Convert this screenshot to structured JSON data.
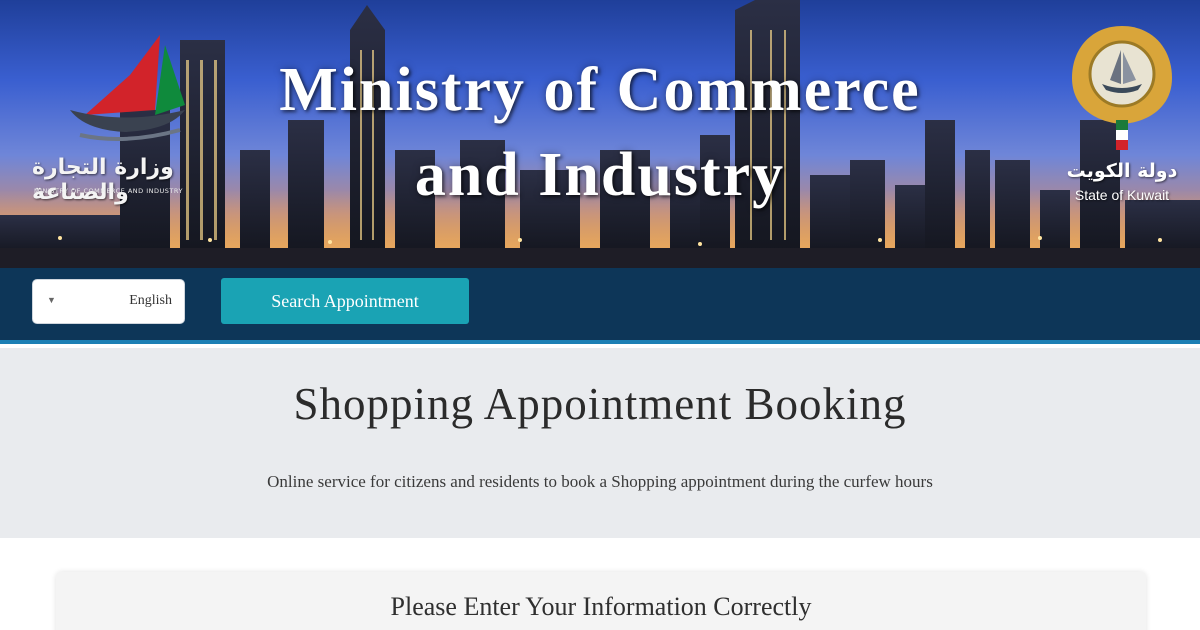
{
  "banner": {
    "title_line1": "Ministry of Commerce",
    "title_line2": "and Industry",
    "ministry_logo_icon": "dhow-sail-logo-icon",
    "ministry_name_ar": "وزارة التجارة والصناعة",
    "ministry_name_en": "MINISTRY OF COMMERCE AND INDUSTRY",
    "state_emblem_icon": "kuwait-emblem-icon",
    "state_name_ar": "دولة الكويت",
    "state_name_en": "State of Kuwait"
  },
  "navbar": {
    "language_select_value": "English",
    "search_button_label": "Search Appointment"
  },
  "hero": {
    "title": "Shopping Appointment Booking",
    "subtitle": "Online service for citizens and residents to book a Shopping appointment during the curfew hours"
  },
  "form": {
    "title": "Please Enter Your Information Correctly"
  },
  "colors": {
    "navbar": "#0d3658",
    "accent_button": "#1aa3b4",
    "hero_bg": "#e9ebee"
  }
}
